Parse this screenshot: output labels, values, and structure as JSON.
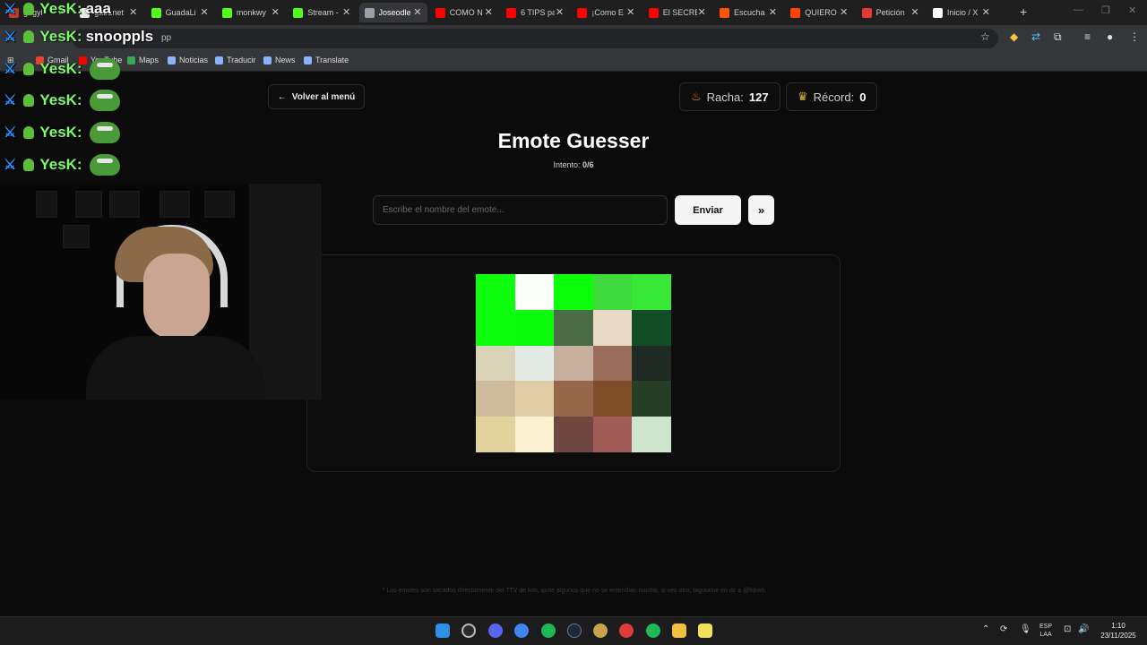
{
  "browser": {
    "tabs": [
      {
        "label": "gegyl",
        "color": "#c0392b",
        "active": false
      },
      {
        "label": "gab1net",
        "color": "#e8e8e8",
        "active": false
      },
      {
        "label": "GuadaLi",
        "color": "#53fc18",
        "active": false
      },
      {
        "label": "monkwy",
        "color": "#53fc18",
        "active": false
      },
      {
        "label": "Stream -",
        "color": "#53fc18",
        "active": false
      },
      {
        "label": "Joseodle",
        "color": "#9aa0a6",
        "active": true
      },
      {
        "label": "COMO N",
        "color": "#ff0000",
        "active": false
      },
      {
        "label": "6 TIPS pa",
        "color": "#ff0000",
        "active": false
      },
      {
        "label": "¡Como E",
        "color": "#ff0000",
        "active": false
      },
      {
        "label": "El SECRE",
        "color": "#ff0000",
        "active": false
      },
      {
        "label": "Escucha",
        "color": "#ff5500",
        "active": false
      },
      {
        "label": "QUIERO",
        "color": "#ff4500",
        "active": false
      },
      {
        "label": "Petición",
        "color": "#e53935",
        "active": false
      },
      {
        "label": "Inicio / X",
        "color": "#ffffff",
        "active": false
      }
    ],
    "new_tab": "+",
    "address_partial": "pp",
    "bookmarks": [
      {
        "label": "Gmail",
        "color": "#ea4335"
      },
      {
        "label": "YouTube",
        "color": "#ff0000"
      },
      {
        "label": "Maps",
        "color": "#34a853"
      },
      {
        "label": "Noticias",
        "color": "#8ab4f8"
      },
      {
        "label": "Traducir",
        "color": "#8ab4f8"
      },
      {
        "label": "News",
        "color": "#8ab4f8"
      },
      {
        "label": "Translate",
        "color": "#8ab4f8"
      }
    ]
  },
  "game": {
    "back_label": "Volver al menú",
    "streak_label": "Racha:",
    "streak_value": "127",
    "record_label": "Récord:",
    "record_value": "0",
    "title": "Emote Guesser",
    "attempt_label": "Intento:",
    "attempt_value": "0/6",
    "input_placeholder": "Escribe el nombre del emote...",
    "send_label": "Enviar",
    "skip_label": "»",
    "pixel_grid": [
      [
        "#0dff0d",
        "#fbfdfa",
        "#0bff0b",
        "#3dd93d",
        "#37e837"
      ],
      [
        "#0cff0c",
        "#0cfb0c",
        "#4b6b46",
        "#e8d9c6",
        "#124d28"
      ],
      [
        "#d9d4b8",
        "#e2ebe4",
        "#c7b19e",
        "#9a6c5a",
        "#1f2a24"
      ],
      [
        "#ccbc9c",
        "#e0cda6",
        "#95664a",
        "#7f4c28",
        "#263e26"
      ],
      [
        "#e2d39c",
        "#fbf0cf",
        "#6f4640",
        "#a15c58",
        "#cfe4cc"
      ]
    ],
    "footnote": "* Los emotes son sacados directamente del 7TV de lolo, quite algunos que no se entendian mucho, si ves otro, taguiame en dc a @fqkeh"
  },
  "chat": [
    {
      "user": "YesK:",
      "message": "aaa"
    },
    {
      "user": "YesK:",
      "message": "snooppls"
    },
    {
      "user": "YesK:",
      "message": ""
    },
    {
      "user": "YesK:",
      "message": ""
    },
    {
      "user": "YesK:",
      "message": ""
    },
    {
      "user": "YesK:",
      "message": ""
    }
  ],
  "taskbar": {
    "lang_top": "ESP",
    "lang_bottom": "LAA",
    "time": "1:10",
    "date": "23/11/2025"
  }
}
